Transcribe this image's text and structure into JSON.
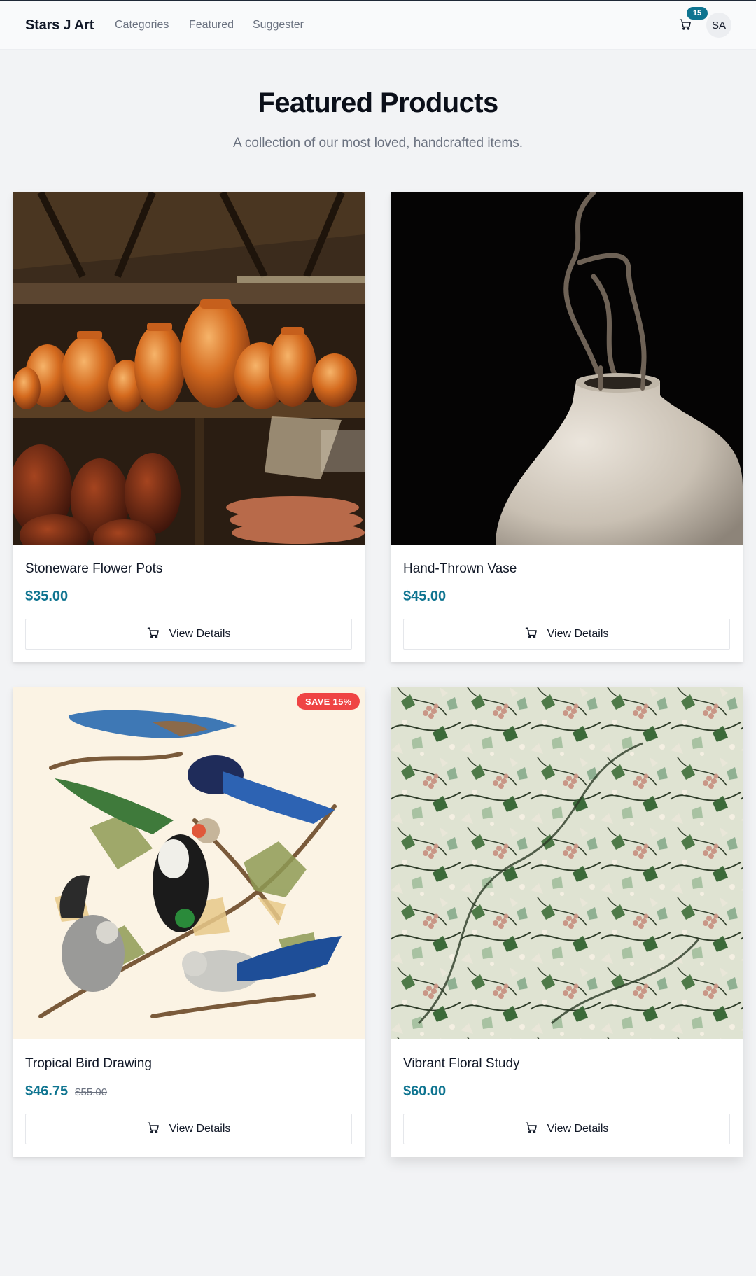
{
  "header": {
    "brand": "Stars J Art",
    "nav": [
      "Categories",
      "Featured",
      "Suggester"
    ],
    "cart_count": "15",
    "avatar_initials": "SA"
  },
  "hero": {
    "title": "Featured Products",
    "subtitle": "A collection of our most loved, handcrafted items."
  },
  "products": [
    {
      "name": "Stoneware Flower Pots",
      "price": "$35.00",
      "button": "View Details",
      "image": "terracotta-pots-photo"
    },
    {
      "name": "Hand-Thrown Vase",
      "price": "$45.00",
      "button": "View Details",
      "image": "white-vase-branch-photo"
    },
    {
      "name": "Tropical Bird Drawing",
      "price": "$46.75",
      "old_price": "$55.00",
      "badge": "SAVE 15%",
      "button": "View Details",
      "image": "blue-jays-illustration"
    },
    {
      "name": "Vibrant Floral Study",
      "price": "$60.00",
      "button": "View Details",
      "image": "floral-pattern-print"
    }
  ],
  "colors": {
    "accent": "#0e7490",
    "sale": "#ef4444",
    "background": "#f2f3f5"
  },
  "icons": {
    "cart": "cart-icon"
  }
}
